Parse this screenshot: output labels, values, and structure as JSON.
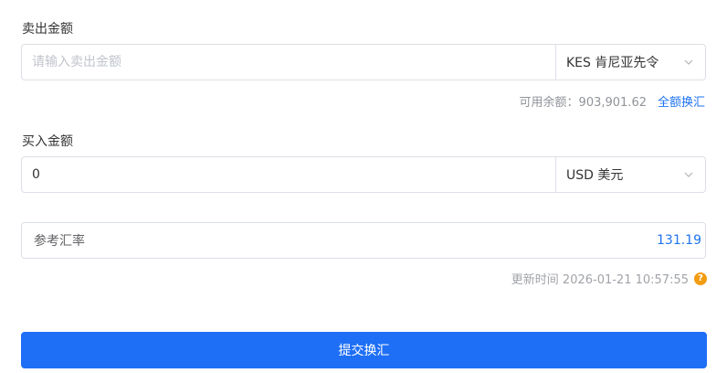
{
  "colors": {
    "accent": "#1e6ff5",
    "link": "#1e73f0",
    "warning": "#f39c12",
    "border": "#dcdfe6"
  },
  "sell": {
    "label": "卖出金额",
    "placeholder": "请输入卖出金额",
    "value": "",
    "currency": "KES 肯尼亚先令"
  },
  "balance": {
    "text": "可用余额：903,901.62",
    "exchange_all": "全额换汇"
  },
  "buy": {
    "label": "买入金额",
    "value": "0",
    "currency": "USD 美元"
  },
  "rate": {
    "label": "参考汇率",
    "value": "131.19"
  },
  "update": {
    "text": "更新时间 2026-01-21 10:57:55",
    "help_icon": "question-circle-icon"
  },
  "submit_label": "提交换汇"
}
